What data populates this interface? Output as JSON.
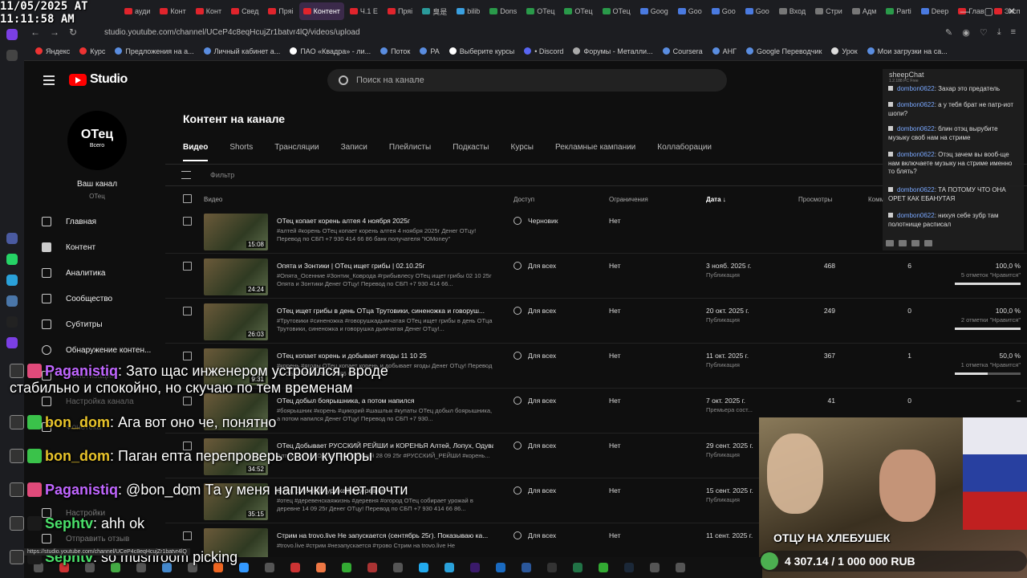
{
  "clock": {
    "line1": "11/05/2025 AT",
    "line2": "11:11:58 AM"
  },
  "browser": {
    "tabs": [
      "ауди",
      "Конт",
      "Конт",
      "Свед",
      "Пряі",
      "Контент",
      "Ч.1 Е",
      "Пряі",
      "臭是",
      "bilib",
      "Dons",
      "ОТец",
      "ОТец",
      "ОТец",
      "Goog",
      "Goo",
      "Goo",
      "Goo",
      "Вход",
      "Стри",
      "Адм",
      "Parti",
      "Deep",
      "Глав",
      "Эксп"
    ],
    "url": "studio.youtube.com/channel/UCeP4c8eqHcujZr1batvr4lQ/videos/upload",
    "bookmarks": [
      "Яндекс",
      "Курс",
      "Предложения на а...",
      "Личный кабинет а...",
      "ПАО «Квадра» - ли...",
      "Поток",
      "РА",
      "Выберите курсы",
      "• Discord",
      "Форумы - Металли...",
      "Coursera",
      "АНГ",
      "Google Переводчик",
      "Урок",
      "Мои загрузки на са..."
    ]
  },
  "studio": {
    "logo": "Studio",
    "search_placeholder": "Поиск на канале",
    "avatar_main": "ОТец",
    "avatar_sub": "Всего",
    "channel_label": "Ваш канал",
    "channel_name": "ОТец",
    "nav": [
      "Главная",
      "Контент",
      "Аналитика",
      "Сообщество",
      "Субтитры",
      "Обнаружение контен...",
      "Монетизация",
      "Настройка канала",
      "Фонотека",
      "Настройки",
      "Отправить отзыв"
    ],
    "page_title": "Контент на канале",
    "tabs": [
      "Видео",
      "Shorts",
      "Трансляции",
      "Записи",
      "Плейлисты",
      "Подкасты",
      "Курсы",
      "Рекламные кампании",
      "Коллаборации"
    ],
    "filter_label": "Фильтр",
    "columns": {
      "video": "Видео",
      "access": "Доступ",
      "limits": "Ограничения",
      "date": "Дата ↓",
      "views": "Просмотры",
      "comments": "Комм"
    },
    "rows": [
      {
        "title": "ОТец копает корень алтея 4 ноября 2025г",
        "desc": "#алтей #корень ОТец копает корень алтея 4 ноября 2025г Денег ОТцу! Перевод по СБП +7 930 414 66 86 банк получателя \"ЮMoney\"",
        "duration": "15:08",
        "access": "Черновик",
        "limits": "Нет",
        "date": "",
        "date_sub": "",
        "views": "",
        "comments": "",
        "likes": "",
        "likes_sub": "",
        "likes_pct": 0
      },
      {
        "title": "Опята и Зонтики | ОТец ищет грибы | 02.10.25г",
        "desc": "#Опята_Осенние #Зонтик_Коврода #грибывлесу ОТец ищет грибы 02 10 25г Опята и Зонтики Денег ОТцу! Перевод по СБП +7 930 414 66...",
        "duration": "24:24",
        "access": "Для всех",
        "limits": "Нет",
        "date": "3 нояб. 2025 г.",
        "date_sub": "Публикация",
        "views": "468",
        "comments": "6",
        "likes": "100,0 %",
        "likes_sub": "5 отметок \"Нравится\"",
        "likes_pct": 100
      },
      {
        "title": "ОТец ищет грибы в день ОТца Трутовики, синеножка и говоруш...",
        "desc": "#Трутовики #синеножка #говорушкадымчатая ОТец ищет грибы в день ОТца Трутовики, синеножка и говорушка дымчатая Денег ОТцу!...",
        "duration": "26:03",
        "access": "Для всех",
        "limits": "Нет",
        "date": "20 окт. 2025 г.",
        "date_sub": "Публикация",
        "views": "249",
        "comments": "0",
        "likes": "100,0 %",
        "likes_sub": "2 отметки \"Нравится\"",
        "likes_pct": 100
      },
      {
        "title": "ОТец копает корень и добывает ягоды 11 10 25",
        "desc": "#корень #ягоды ОТец копает корень и добывает ягоды Денег ОТцу! Перевод по СБП +7 930 414 66 86 банк...",
        "duration": "9:31",
        "access": "Для всех",
        "limits": "Нет",
        "date": "11 окт. 2025 г.",
        "date_sub": "Публикация",
        "views": "367",
        "comments": "1",
        "likes": "50,0 %",
        "likes_sub": "1 отметка \"Нравится\"",
        "likes_pct": 50
      },
      {
        "title": "ОТец добыл боярышника, а потом напился",
        "desc": "#боярышник #корень #цикорий #шашлык #купаты ОТец добыл боярышника, а потом напился Денег ОТцу! Перевод по СБП +7 930...",
        "duration": "",
        "access": "Для всех",
        "limits": "Нет",
        "date": "7 окт. 2025 г.",
        "date_sub": "Премьера сост...",
        "views": "41",
        "comments": "0",
        "likes": "–",
        "likes_sub": "",
        "likes_pct": 0
      },
      {
        "title": "ОТец Добывает РУССКИЙ РЕЙШИ и КОРЕНЬЯ Алтей, Лопух, Одува...",
        "desc": "Алтей, Лопух, Одуванчик, Цикорий 28 09 25г #РУССКИЙ_РЕЙШИ #корень...",
        "duration": "34:52",
        "access": "Для всех",
        "limits": "Нет",
        "date": "29 сент. 2025 г.",
        "date_sub": "Публикация",
        "views": "",
        "comments": "",
        "likes": "",
        "likes_sub": "",
        "likes_pct": 0
      },
      {
        "title": "ОТец собирает урожай в деревне",
        "desc": "#отец #деревенскаяжизнь #деревня #огород ОТец собирает урожай в деревне 14 09 25г Денег ОТцу! Перевод по СБП +7 930 414 66 86...",
        "duration": "35:15",
        "access": "Для всех",
        "limits": "Нет",
        "date": "15 сент. 2025 г.",
        "date_sub": "Публикация",
        "views": "",
        "comments": "",
        "likes": "",
        "likes_sub": "",
        "likes_pct": 0
      },
      {
        "title": "Стрим на trovo.live Не запускается (сентябрь 25г). Показываю ка...",
        "desc": "#trovo.live #стрим #незапускается #трово Стрим на trovo.live Не",
        "duration": "",
        "access": "Для всех",
        "limits": "Нет",
        "date": "11 сент. 2025 г.",
        "date_sub": "",
        "views": "",
        "comments": "",
        "likes": "",
        "likes_sub": "",
        "likes_pct": 0
      }
    ]
  },
  "sheepchat": {
    "title": "sheepChat",
    "version": "1.2.188 PC Free",
    "messages": [
      {
        "user": "dombon0622",
        "text": "Захар это предатель"
      },
      {
        "user": "dombon0622",
        "text": "а у тебя брат не патр-иот шопи?"
      },
      {
        "user": "dombon0622",
        "text": "блин отэц вырубите музыку своб нам на стриме"
      },
      {
        "user": "dombon0622",
        "text": "Отэц зачем вы вооб-ще нам включаете музыку на стриме именно то блять?"
      },
      {
        "user": "dombon0622",
        "text": "ТА ПОТОМУ ЧТО ОНА ОРЕТ КАК ЕБАНУТАЯ"
      },
      {
        "user": "dombon0622",
        "text": "нихуя себе зубр там полотнище расписал"
      }
    ]
  },
  "overlay_chat": [
    {
      "user": "Paganistiq",
      "text": "Зато щас инженером устроился, вроде",
      "text2": "стабильно и спокойно, но скучаю по тем временам",
      "color": "#c066ff"
    },
    {
      "user": "bon_dom",
      "text": "Ага вот оно че, понятно",
      "text2": "",
      "color": "#e8c32a"
    },
    {
      "user": "bon_dom",
      "text": "Паган епта перепроверь свои купюры",
      "text2": "",
      "color": "#e8c32a"
    },
    {
      "user": "Paganistiq",
      "text": "@bon_dom Та у меня напички и нет почти",
      "text2": "",
      "color": "#c066ff"
    },
    {
      "user": "Sephtv",
      "text": "ahh ok",
      "text2": "",
      "color": "#4ae06a"
    },
    {
      "user": "Sephtv",
      "text": "so mushroom picking",
      "text2": "",
      "color": "#4ae06a"
    }
  ],
  "stream": {
    "title": "ОТЦУ НА ХЛЕБУШЕК",
    "goal": "4 307.14 / 1 000 000 RUB"
  },
  "status_link": "https://studio.youtube.com/channel/UCeP4c8eqHcujZr1batvr4lQ"
}
